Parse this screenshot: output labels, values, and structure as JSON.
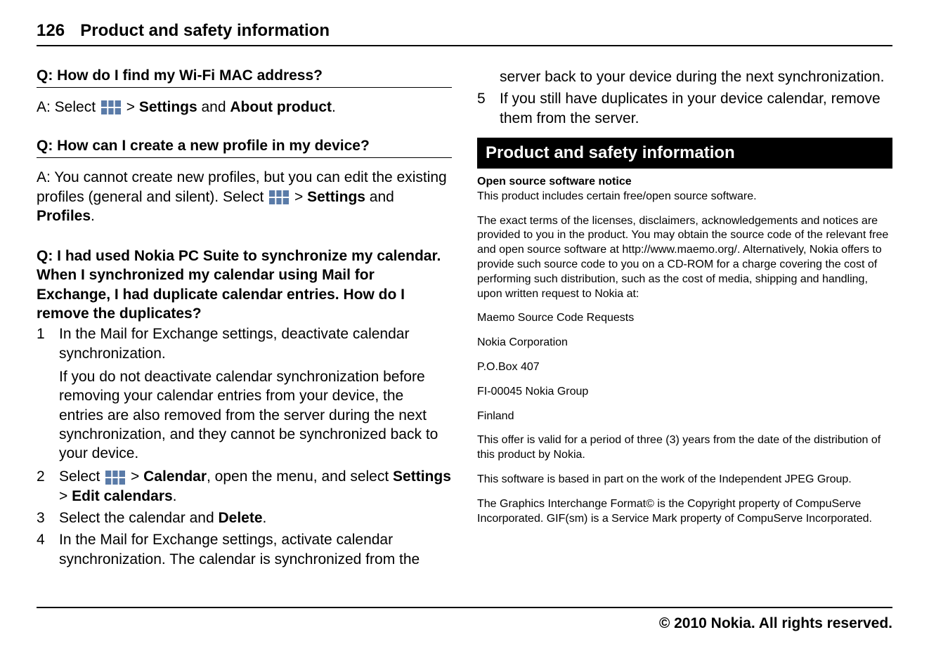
{
  "header": {
    "page_number": "126",
    "title": "Product and safety information"
  },
  "left": {
    "q1": {
      "question": "Q: How do I find my Wi-Fi MAC address?",
      "answer_prefix": "A: Select ",
      "answer_gt": " > ",
      "answer_settings": "Settings",
      "answer_and": " and ",
      "answer_about": "About product",
      "answer_period": "."
    },
    "q2": {
      "question": "Q: How can I create a new profile in my device?",
      "answer_line1a": "A: You cannot create new profiles, but you can edit the existing profiles (general and silent). Select ",
      "answer_gt": " > ",
      "answer_settings": "Settings",
      "answer_and": " and ",
      "answer_profiles": "Profiles",
      "answer_period": "."
    },
    "q3": {
      "question": "Q: I had used Nokia PC Suite to synchronize my calendar. When I synchronized my calendar using Mail for Exchange, I had duplicate calendar entries. How do I remove the duplicates?",
      "step1": "In the Mail for Exchange settings, deactivate calendar synchronization.",
      "step1_note": "If you do not deactivate calendar synchronization before removing your calendar entries from your device, the entries are also removed from the server during the next synchronization, and they cannot be synchronized back to your device.",
      "step2_prefix": "Select ",
      "step2_gt1": " > ",
      "step2_calendar": "Calendar",
      "step2_mid": ", open the menu, and select ",
      "step2_settings": "Settings ",
      "step2_gt2": " > ",
      "step2_edit": "Edit calendars",
      "step2_period": ".",
      "step3_a": "Select the calendar and ",
      "step3_delete": "Delete",
      "step3_period": ".",
      "step4": "In the Mail for Exchange settings, activate calendar synchronization. The calendar is synchronized from the "
    }
  },
  "right": {
    "cont1": "server back to your device during the next synchronization.",
    "step5": "If you still have duplicates in your device calendar, remove them from the server.",
    "section_title": "Product and safety information",
    "oss_heading": "Open source software notice",
    "oss_p1": "This product includes certain free/open source software.",
    "oss_p2": "The exact terms of the licenses, disclaimers, acknowledgements and notices are provided to you in the product. You may obtain the source code of the relevant free and open source software at http://www.maemo.org/. Alternatively, Nokia offers to provide such source code to you on a CD-ROM for a charge covering the cost of performing such distribution, such as the cost of media, shipping and handling, upon written request to Nokia at:",
    "addr1": "Maemo Source Code Requests",
    "addr2": "Nokia Corporation",
    "addr3": "P.O.Box 407",
    "addr4": "FI-00045 Nokia Group",
    "addr5": "Finland",
    "oss_p3": "This offer is valid for a period of three (3) years from the date of the distribution of this product by Nokia.",
    "oss_p4": "This software is based in part on the work of the Independent JPEG Group.",
    "oss_p5": "The Graphics Interchange Format© is the Copyright property of CompuServe Incorporated. GIF(sm) is a Service Mark property of CompuServe Incorporated."
  },
  "footer": "© 2010 Nokia. All rights reserved."
}
